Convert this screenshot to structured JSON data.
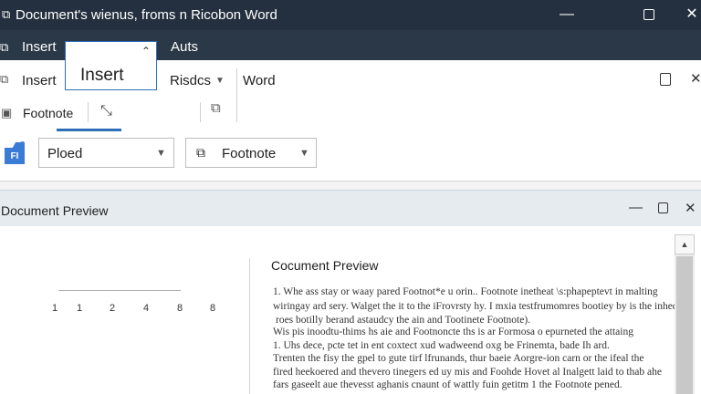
{
  "window": {
    "title": "Document's wienus, froms n Ricobon Word",
    "minimize": "—",
    "close": "✕"
  },
  "tabs": [
    "Insert",
    "Auts"
  ],
  "ribbon": {
    "insert_label": "Insert",
    "footnote_label": "Footnote",
    "popup_label": "Insert",
    "risdcs_label": "Risdcs",
    "word_label": "Word",
    "dropdown_left": "Ploed",
    "dropdown_right": "Footnote",
    "fi_icon_text": "FI"
  },
  "preview": {
    "header_title": "Document Preview",
    "page_title": "Cocument Preview",
    "ruler": [
      "1",
      "1",
      "2",
      "4",
      "8",
      "8"
    ],
    "paragraphs": [
      "1.    Whe ass stay or waay pared Footnot*e u orin.. Footnote inetheat \\s:phapeptevt in malting",
      "wiringay ard sery. Walget the it to the iFrovrsty hy.  I mxia testfrumomres bootiey by is the inhed",
      "roes botilly berand astaudcy the ain and Tootinete Footnote).",
      "      Wis pis inoodtu-thims hs aie and Footnoncte ths is ar Formosa o epurneted the attaing",
      "1.   Uhs dece, pcte tet in ent coxtect xud wadweend oxg be Frinemta, bade Ih ard.",
      "     Trenten the fisy the gpel to gute tirf lfrunands, thur baeie Aorgre-ion carn or the ifeal the",
      "   fired heekoered and thevero tinegers ed uy mis and Foohde Hovet al Inalgett laid to thab ahe",
      "fars gaseelt aue thevesst aghanis cnaunt of wattly fuin getitm 1 the Footnote pened."
    ]
  }
}
